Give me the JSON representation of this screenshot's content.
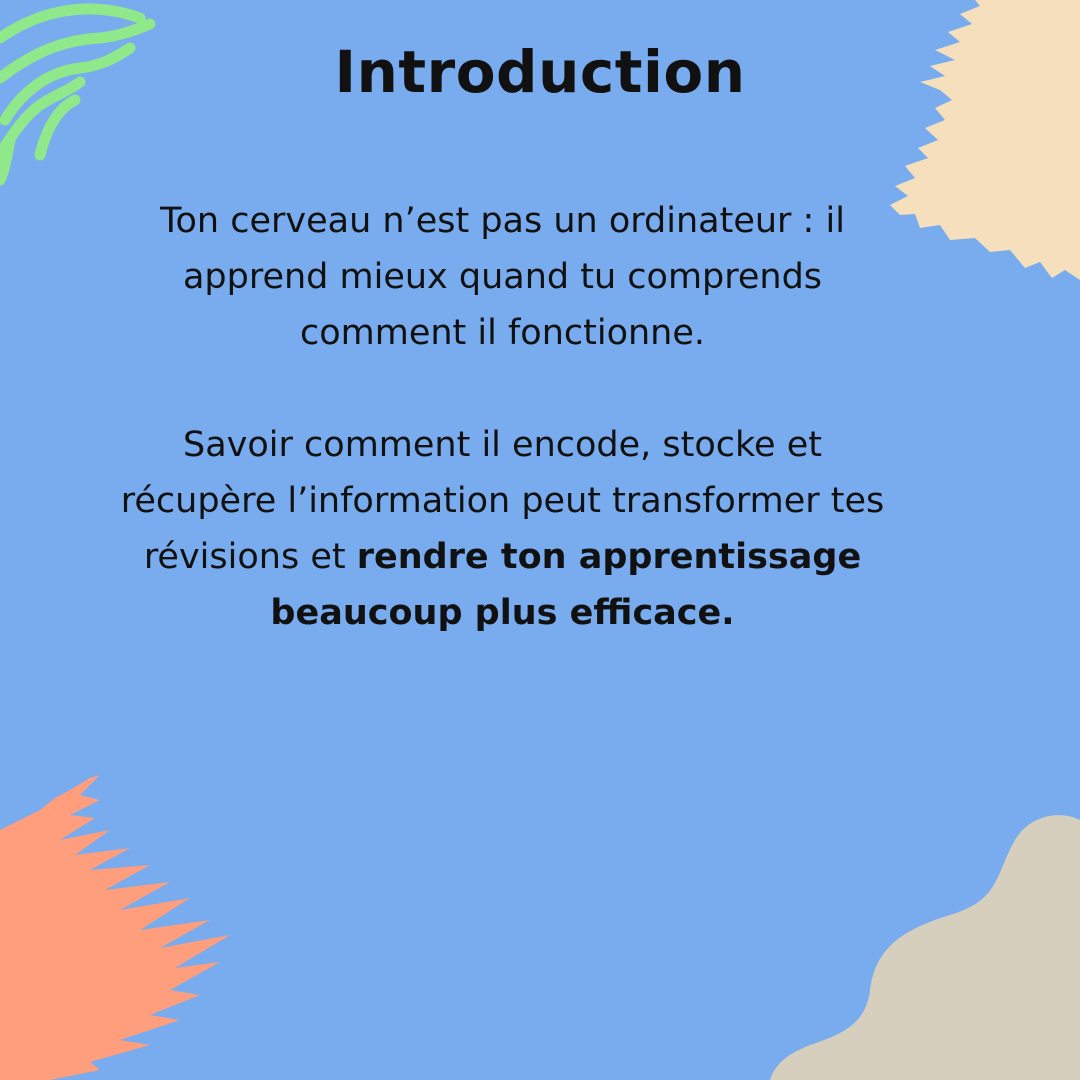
{
  "slide": {
    "title": "Introduction",
    "paragraph1": "Ton cerveau n’est pas un ordinateur : il apprend mieux quand tu comprends comment il fonctionne.",
    "paragraph2_lead": "Savoir comment il encode, stocke et récupère l’information peut transformer tes révisions et ",
    "paragraph2_bold": "rendre ton apprentissage beaucoup plus efficace."
  },
  "colors": {
    "background": "#78acee",
    "green_lines": "#8fe88a",
    "cream_brush": "#f5dfbd",
    "coral_brush": "#ff9e7c",
    "taupe_blob": "#d6cfbe",
    "text": "#111111"
  },
  "decorations": [
    "green-wavy-lines",
    "cream-brush-stroke",
    "coral-brush-stroke",
    "taupe-blob"
  ]
}
